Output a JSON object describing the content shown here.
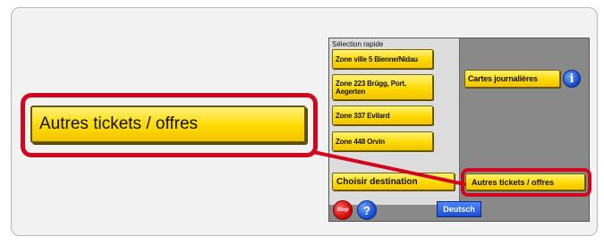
{
  "callout": {
    "label": "Autres tickets / offres"
  },
  "screen": {
    "section_title": "Sélection rapide",
    "zones": [
      "Zone ville 5 Bienne/Nidau",
      "Zone 223 Brügg, Port, Aegerten",
      "Zone 337 Evilard",
      "Zone 448 Orvin"
    ],
    "day_passes_label": "Cartes journalières",
    "choose_destination_label": "Choisir destination",
    "other_tickets_label": "Autres tickets / offres",
    "info_icon_glyph": "i",
    "stop_label": "Stop",
    "help_glyph": "?",
    "language_label": "Deutsch"
  },
  "colors": {
    "highlight": "#d2051e",
    "button_yellow": "#ffd900",
    "screen_gray": "#898989"
  }
}
